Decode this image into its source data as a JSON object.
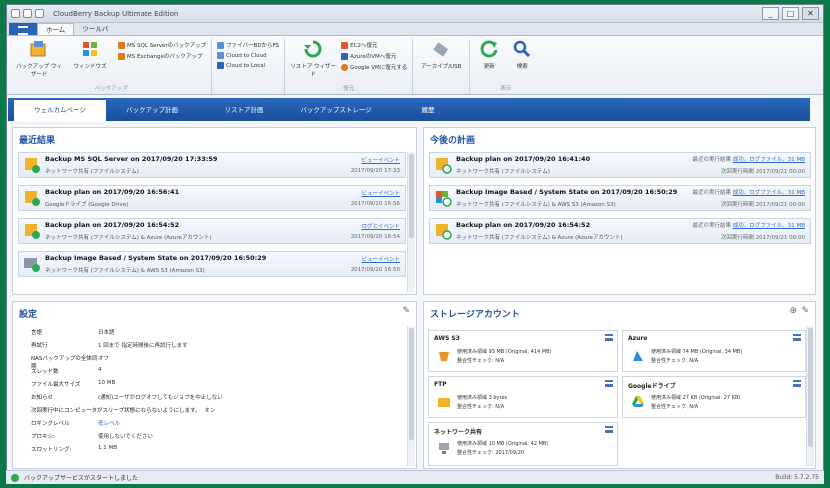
{
  "window": {
    "title": "CloudBerry Backup Ultimate Edition",
    "controls": [
      "_",
      "□",
      "✕"
    ]
  },
  "file_tabs": [
    "ホーム",
    "ツールバ"
  ],
  "ribbon": {
    "groups": [
      {
        "name": "",
        "big": [
          {
            "label": "バックアップ ウィザード",
            "icon": "backup-wizard-icon"
          },
          {
            "label": "ウィンドウズ",
            "icon": "windows-icon"
          }
        ],
        "small": [
          {
            "label": "MS SQL Serverのバックアップ",
            "color": "#e07b1a"
          },
          {
            "label": "MS Exchangeのバックアップ",
            "color": "#e07b1a"
          }
        ],
        "caption": "バックアップ"
      },
      {
        "name": "",
        "big": [],
        "small": [
          {
            "label": "ファイバーBDからFS",
            "color": "#5b8fd6"
          },
          {
            "label": "Cloud to Cloud",
            "color": "#5b8fd6"
          },
          {
            "label": "Cloud to Local",
            "color": "#2a63b5"
          }
        ],
        "caption": ""
      },
      {
        "name": "",
        "big": [
          {
            "label": "リストア ウィザード",
            "icon": "restore-wizard-icon"
          }
        ],
        "small": [
          {
            "label": "EC2へ復元",
            "color": "#e0592a"
          },
          {
            "label": "AzureのVMへ復元",
            "color": "#2a63b5"
          },
          {
            "label": "Google VMに復元する",
            "color": "#e07b1a"
          }
        ],
        "caption": "復元"
      },
      {
        "name": "",
        "big": [
          {
            "label": "アーカイブ/USB",
            "icon": "usb-drive-icon"
          }
        ],
        "small": [],
        "caption": ""
      },
      {
        "name": "",
        "big": [
          {
            "label": "更新",
            "icon": "refresh-icon"
          },
          {
            "label": "検索",
            "icon": "search-icon"
          }
        ],
        "small": [],
        "caption": "表示"
      }
    ]
  },
  "nav_tabs": [
    "ウェルカムページ",
    "バックアップ計画",
    "リストア計画",
    "バックアップストレージ",
    "履歴"
  ],
  "recent": {
    "title": "最近結果",
    "items": [
      {
        "title": "Backup MS SQL Server on 2017/09/20 17:33:59",
        "dest": "ネットワーク共有 (ファイルシステム)",
        "link": "ビューイベント",
        "date": "2017/09/20 17:33"
      },
      {
        "title": "Backup plan on 2017/09/20 16:56:41",
        "dest": "Googleドライブ (Google Drive)",
        "link": "ビューイベント",
        "date": "2017/09/20 16:56"
      },
      {
        "title": "Backup plan on 2017/09/20 16:54:52",
        "dest": "ネットワーク共有 (ファイルシステム) & Azure (Azureアカウント)",
        "link": "ログとイベント",
        "date": "2017/09/20 16:54"
      },
      {
        "title": "Backup Image Based / System State on 2017/09/20 16:50:29",
        "dest": "ネットワーク共有 (ファイルシステム) & AWS S3 (Amazon S3)",
        "link": "ビューイベント",
        "date": "2017/09/20 16:50"
      }
    ]
  },
  "upcoming": {
    "title": "今後の計画",
    "items": [
      {
        "title": "Backup plan on 2017/09/20 16:41:40",
        "dest": "ネットワーク共有 (ファイルシステム)",
        "last": "最近の実行結果",
        "link": "成功、ログファイル、31 MB",
        "next": "次回実行時間",
        "next_val": "2017/09/21 00:00"
      },
      {
        "title": "Backup Image Based / System State on 2017/09/20 16:50:29",
        "dest": "ネットワーク共有 (ファイルシステム) & AWS S3 (Amazon S3)",
        "last": "最近の実行結果",
        "link": "成功、ログファイル、31 MB",
        "next": "次回実行時間",
        "next_val": "2017/09/21 00:00"
      },
      {
        "title": "Backup plan on 2017/09/20 16:54:52",
        "dest": "ネットワーク共有 (ファイルシステム) & Azure (Azureアカウント)",
        "last": "最近の実行結果",
        "link": "成功、ログファイル、31 MB",
        "next": "次回実行時間",
        "next_val": "2017/09/21 00:00"
      }
    ]
  },
  "settings": {
    "title": "設定",
    "rows": [
      {
        "k": "言語",
        "v": "日本語"
      },
      {
        "k": "再試行",
        "v": "1 回まで 指定時間後に再試行します"
      },
      {
        "k": "NASバックアップの全体同期",
        "v": "オフ"
      },
      {
        "k": "スレッド数",
        "v": "4"
      },
      {
        "k": "ファイル最大サイズ",
        "v": "10 MB"
      },
      {
        "k": "お知らせ",
        "v": "(通知)ユーザがログオフしてもジョブを中止しない"
      },
      {
        "k": "次回実行中にコンピュータがスリープ状態にならないようにします。",
        "v": "オン"
      },
      {
        "k": "ロギングレベル",
        "v": "低レベル",
        "link": true
      },
      {
        "k": "プロキシ:",
        "v": "使用しないでください"
      },
      {
        "k": "スロットリング:",
        "v": "1.1 MB"
      }
    ]
  },
  "storage": {
    "title": "ストレージアカウント",
    "accounts": [
      {
        "name": "AWS S3",
        "icon": "aws-s3-icon",
        "line1": "使用済み領域 93 MB (Original: 414 MB)",
        "line2": "整合性チェック: N/A"
      },
      {
        "name": "Azure",
        "icon": "azure-icon",
        "line1": "使用済み領域 74 MB (Original: 34 MB)",
        "line2": "整合性チェック: N/A"
      },
      {
        "name": "FTP",
        "icon": "ftp-icon",
        "line1": "使用済み領域 3 bytes",
        "line2": "整合性チェック: N/A"
      },
      {
        "name": "Googleドライブ",
        "icon": "google-drive-icon",
        "line1": "使用済み領域 27 KB (Original: 27 KB)",
        "line2": "整合性チェック: N/A"
      },
      {
        "name": "ネットワーク共有",
        "icon": "network-share-icon",
        "line1": "使用済み領域 10 MB (Original: 42 MB)",
        "line2": "整合性チェック: 2017/09/20"
      }
    ]
  },
  "status": {
    "text": "バックアップサービスがスタートしました",
    "build": "Build: 5.7.2.75"
  },
  "colors": {
    "accent": "#1d4f98",
    "link": "#2e6ad1",
    "ok": "#2fa84f",
    "frame": "#0c7a48"
  }
}
